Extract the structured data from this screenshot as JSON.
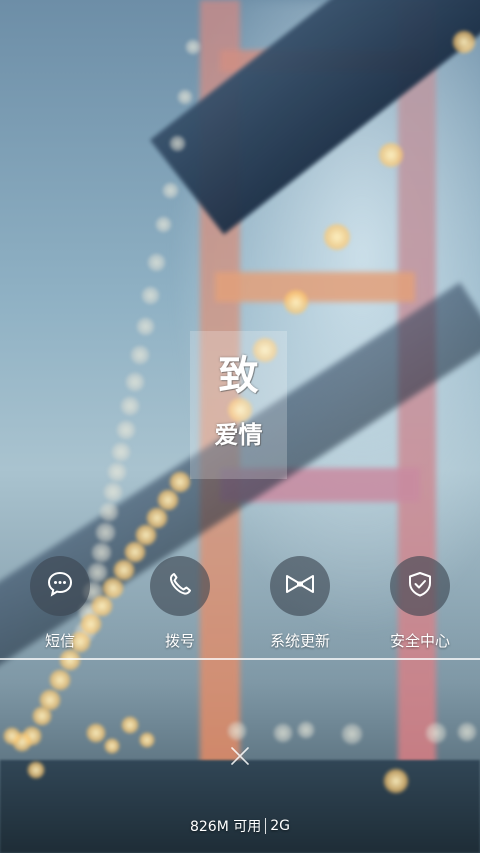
{
  "title": {
    "main": "致",
    "sub": "爱情"
  },
  "shortcuts": [
    {
      "label": "短信",
      "icon": "message-bubble-icon"
    },
    {
      "label": "拨号",
      "icon": "phone-icon"
    },
    {
      "label": "系统更新",
      "icon": "bowtie-update-icon"
    },
    {
      "label": "安全中心",
      "icon": "shield-check-icon"
    }
  ],
  "footer": {
    "memory": "826M 可用",
    "network": "2G"
  },
  "colors": {
    "circle_bg": "#3c4650",
    "text": "#ffffff"
  }
}
